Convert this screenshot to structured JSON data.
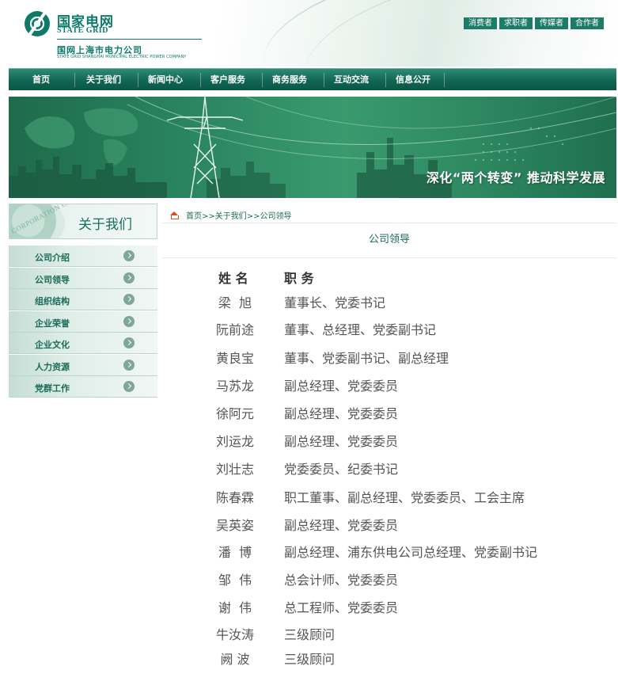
{
  "header": {
    "logo_cn": "国家电网",
    "logo_en": "STATE GRID",
    "company_cn": "国网上海市电力公司",
    "company_en": "STATE GRID SHANGHAI MUNICIPAL ELECTRIC POWER COMPANY",
    "quick_links": [
      "消费者",
      "求职者",
      "传媒者",
      "合作者"
    ]
  },
  "nav": {
    "items": [
      "首页",
      "关于我们",
      "新闻中心",
      "客户服务",
      "商务服务",
      "互动交流",
      "信息公开"
    ]
  },
  "banner": {
    "slogan": "深化“两个转变” 推动科学发展"
  },
  "sidebar": {
    "head_deco": "CORPORATION OF",
    "title": "关于我们",
    "items": [
      "公司介绍",
      "公司领导",
      "组织结构",
      "企业荣誉",
      "企业文化",
      "人力资源",
      "党群工作"
    ]
  },
  "main": {
    "breadcrumb": "首页>>关于我们>>公司领导",
    "title": "公司领导",
    "col_name": "姓 名",
    "col_position": "职 务",
    "leaders": [
      {
        "name": "梁  旭",
        "position": "董事长、党委书记"
      },
      {
        "name": "阮前途",
        "position": "董事、总经理、党委副书记"
      },
      {
        "name": "黄良宝",
        "position": "董事、党委副书记、副总经理"
      },
      {
        "name": "马苏龙",
        "position": "副总经理、党委委员"
      },
      {
        "name": "徐阿元",
        "position": "副总经理、党委委员"
      },
      {
        "name": "刘运龙",
        "position": "副总经理、党委委员"
      },
      {
        "name": "刘壮志",
        "position": "党委委员、纪委书记"
      },
      {
        "name": "陈春霖",
        "position": "职工董事、副总经理、党委委员、工会主席"
      },
      {
        "name": "吴英姿",
        "position": "副总经理、党委委员"
      },
      {
        "name": "潘  博",
        "position": "副总经理、浦东供电公司总经理、党委副书记"
      },
      {
        "name": "邹  伟",
        "position": "总会计师、党委委员"
      },
      {
        "name": "谢  伟",
        "position": "总工程师、党委委员"
      },
      {
        "name": "牛汝涛",
        "position": "三级顾问"
      },
      {
        "name": "阙 波",
        "position": "三级顾问"
      }
    ]
  },
  "colors": {
    "brand_green": "#0d7a6a",
    "nav_green": "#106654",
    "home_icon": "#d84b1b"
  }
}
